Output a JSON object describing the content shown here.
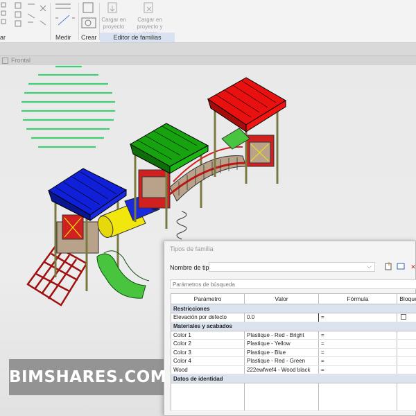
{
  "ribbon": {
    "partial_label": "ar",
    "measure_label": "Medir",
    "create_label": "Crear",
    "load_project_label": "Cargar en proyecto",
    "load_close_label": "Cargar en proyecto y cerrar",
    "family_editor_label": "Editor de familias"
  },
  "view": {
    "tab_label": "Frontal"
  },
  "dialog": {
    "title": "Tipos de familia",
    "type_name_label": "Nombre de tipo:",
    "type_name_value": "",
    "search_placeholder": "Parámetros de búsqueda",
    "columns": [
      "Parámetro",
      "Valor",
      "Fórmula",
      "Bloque"
    ],
    "groups": [
      {
        "name": "Restricciones",
        "rows": [
          {
            "param": "Elevación por defecto",
            "value": "0.0",
            "formula": "=",
            "lock": true
          }
        ]
      },
      {
        "name": "Materiales y acabados",
        "rows": [
          {
            "param": "Color 1",
            "value": "Plastique - Red - Bright",
            "formula": "="
          },
          {
            "param": "Color 2",
            "value": "Plastique - Yellow",
            "formula": "="
          },
          {
            "param": "Color 3",
            "value": "Plastique - Blue",
            "formula": "="
          },
          {
            "param": "Color 4",
            "value": "Plastique - Red - Green",
            "formula": "="
          },
          {
            "param": "Wood",
            "value": "222ewfwef4 - Wood black",
            "formula": "="
          }
        ]
      },
      {
        "name": "Datos de identidad",
        "rows": []
      }
    ]
  },
  "watermark": "BIMSHARES.COM",
  "colors": {
    "roof_red": "#e8110f",
    "roof_green": "#16a30f",
    "roof_blue": "#1020d8",
    "tube_yellow": "#f2e60f",
    "slide_green": "#49c43f",
    "wood": "#b8a38a",
    "group_bg": "#dbe3ee",
    "stripe": "#3fcf73"
  }
}
